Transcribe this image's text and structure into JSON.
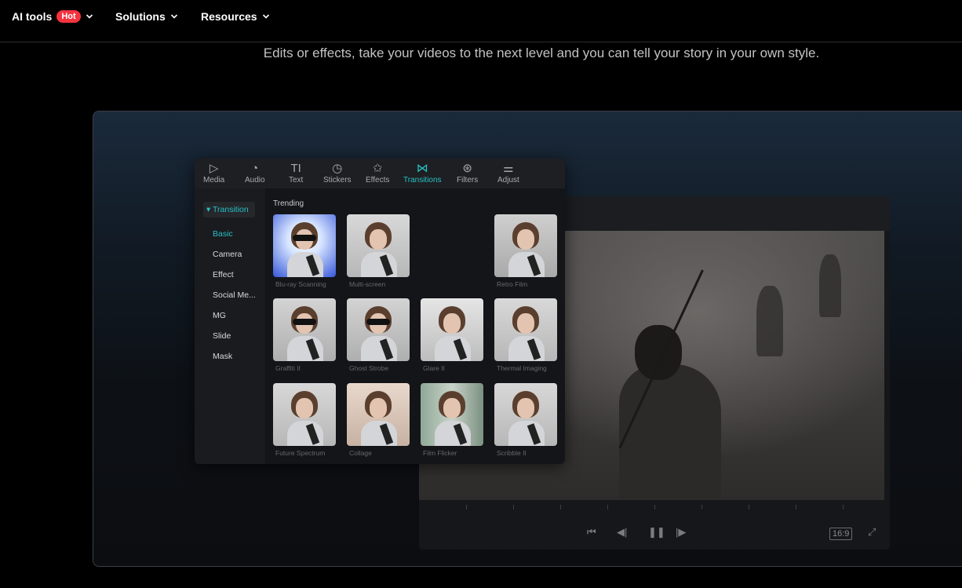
{
  "nav": {
    "items": [
      {
        "label": "AI tools",
        "badge": "Hot"
      },
      {
        "label": "Solutions"
      },
      {
        "label": "Resources"
      }
    ]
  },
  "hero": {
    "subtitle": "Edits or effects, take your videos to the next level and you can tell your story in your own style."
  },
  "editor": {
    "toolbar": [
      {
        "label": "Media",
        "icon": "media-icon",
        "glyph": "▷",
        "active": false
      },
      {
        "label": "Audio",
        "icon": "audio-icon",
        "glyph": "◔",
        "active": false
      },
      {
        "label": "Text",
        "icon": "text-icon",
        "glyph": "TI",
        "active": false
      },
      {
        "label": "Stickers",
        "icon": "stickers-icon",
        "glyph": "◷",
        "active": false
      },
      {
        "label": "Effects",
        "icon": "effects-icon",
        "glyph": "✩",
        "active": false
      },
      {
        "label": "Transitions",
        "icon": "transitions-icon",
        "glyph": "⋈",
        "active": true
      },
      {
        "label": "Filters",
        "icon": "filters-icon",
        "glyph": "⊛",
        "active": false
      },
      {
        "label": "Adjust",
        "icon": "adjust-icon",
        "glyph": "⚌",
        "active": false
      }
    ],
    "category": "Transition",
    "subcategories": [
      "Basic",
      "Camera",
      "Effect",
      "Social Me...",
      "MG",
      "Slide",
      "Mask"
    ],
    "active_subcategory": "Basic",
    "section_label": "Trending",
    "transitions": [
      {
        "label": "Blu-ray Scanning",
        "style": "bluray"
      },
      {
        "label": "Multi-screen",
        "style": "plain"
      },
      {
        "label": "",
        "style": "empty"
      },
      {
        "label": "Retro Film",
        "style": "retro"
      },
      {
        "label": "Graffiti II",
        "style": "glasses"
      },
      {
        "label": "Ghost Strobe",
        "style": "glasses"
      },
      {
        "label": "Glare II",
        "style": "glare"
      },
      {
        "label": "Thermal Imaging",
        "style": "plain"
      },
      {
        "label": "Future Spectrum",
        "style": "plain"
      },
      {
        "label": "Collage",
        "style": "warm"
      },
      {
        "label": "Film Flicker",
        "style": "flicker"
      },
      {
        "label": "Scribble II",
        "style": "plain"
      }
    ]
  },
  "player": {
    "aspect_ratio": "16:9",
    "controls": [
      "skip-back-icon",
      "prev-frame-icon",
      "pause-icon",
      "next-frame-icon",
      "fullscreen-icon"
    ]
  },
  "colors": {
    "accent": "#26c0c7",
    "hot_badge": "#f5333f"
  }
}
